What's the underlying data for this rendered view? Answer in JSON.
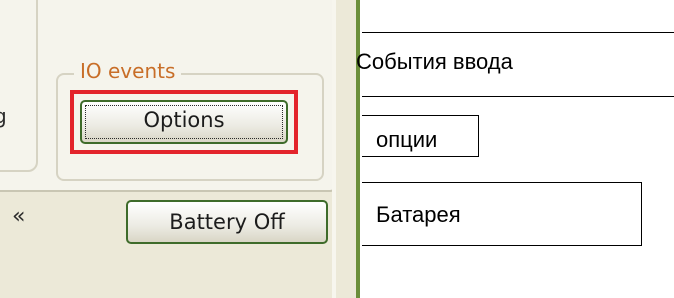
{
  "dialog": {
    "partial_left_char": "g",
    "io_group": {
      "legend": "IO events",
      "options_button_label": "Options"
    },
    "battery_button_label": "Battery Off",
    "colors": {
      "dialog_bg": "#ece9d8",
      "legend_text": "#c86e28",
      "highlight": "#e3242b",
      "button_border": "#3e6b2a"
    },
    "icons": [
      "double-arrow-left-icon"
    ]
  },
  "annotations": {
    "input_events": "События ввода",
    "options": "опции",
    "battery": "Батарея"
  }
}
